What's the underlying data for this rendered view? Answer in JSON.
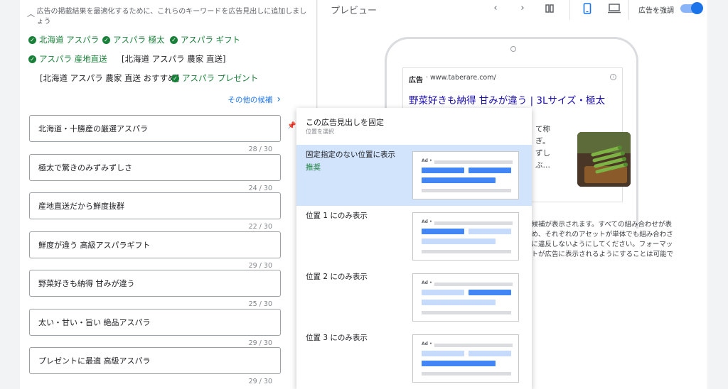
{
  "suggestions": {
    "header_text": "広告の掲載結果を最適化するために、これらのキーワードを広告見出しに追加しましょう",
    "keywords": [
      {
        "text": "北海道 アスパラ",
        "added": true
      },
      {
        "text": "アスパラ 極太",
        "added": true
      },
      {
        "text": "アスパラ ギフト",
        "added": true
      },
      {
        "text": "アスパラ 産地直送",
        "added": true
      },
      {
        "text": "[北海道 アスパラ 農家 直送]",
        "added": false
      },
      {
        "text": "[北海道 アスパラ 農家 直送 おすすめ]",
        "added": false
      },
      {
        "text": "アスパラ プレゼント",
        "added": true
      }
    ],
    "more_label": "その他の候補"
  },
  "headlines": [
    {
      "text": "北海道・十勝産の厳選アスパラ",
      "count": "28 / 30"
    },
    {
      "text": "極太で驚きのみずみずしさ",
      "count": "24 / 30"
    },
    {
      "text": "産地直送だから鮮度抜群",
      "count": "22 / 30"
    },
    {
      "text": "鮮度が違う 高級アスパラギフト",
      "count": "29 / 30"
    },
    {
      "text": "野菜好きも納得 甘みが違う",
      "count": "25 / 30"
    },
    {
      "text": "太い・甘い・旨い 絶品アスパラ",
      "count": "29 / 30"
    },
    {
      "text": "プレゼントに最適 高級アスパラ",
      "count": "29 / 30"
    }
  ],
  "preview": {
    "title": "プレビュー",
    "emphasize_label": "広告を強調",
    "emphasize_on": true,
    "ad": {
      "label": "広告",
      "url": "· www.taberare.com/",
      "headline": "野菜好きも納得 甘みが違う | 3Lサイズ・極太",
      "desc_lines": [
        "て称",
        "ぎ。",
        "ずし",
        "ぶ…"
      ]
    },
    "info_lines": [
      "の候補が表示されます。すべての組み合わせが表",
      "ため、それぞれのアセットが単体でも組み合わさ",
      "律に違反しないようにしてください。フォーマッ",
      "ストが広告に表示されるようにすることは可能で"
    ]
  },
  "pin_menu": {
    "title": "この広告見出しを固定",
    "subtitle": "位置を選択",
    "options": [
      {
        "label": "固定指定のない位置に表示",
        "recommended": "推奨",
        "selected": true
      },
      {
        "label": "位置 1 にのみ表示",
        "recommended": "",
        "selected": false
      },
      {
        "label": "位置 2 にのみ表示",
        "recommended": "",
        "selected": false
      },
      {
        "label": "位置 3 にのみ表示",
        "recommended": "",
        "selected": false
      }
    ],
    "thumb_ad_label": "Ad •"
  },
  "colors": {
    "accent": "#1a73e8",
    "check_green": "#188038",
    "selected_bg": "#d2e3fc",
    "thumb_blue": "#4285f4",
    "thumb_light": "#c6dafc"
  }
}
